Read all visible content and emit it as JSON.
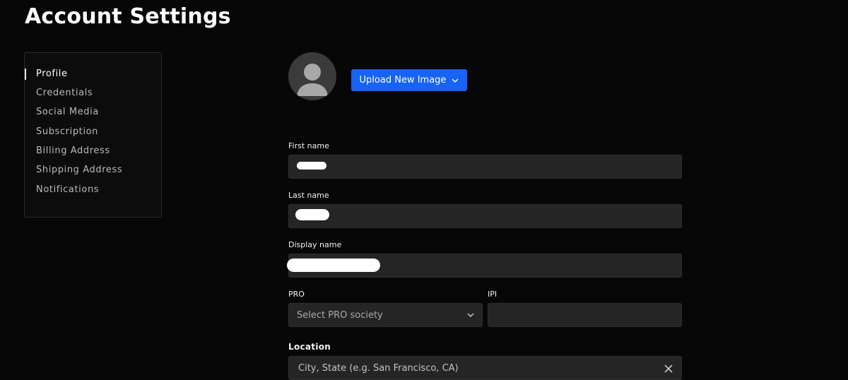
{
  "header": {
    "title": "Account Settings"
  },
  "sidebar": {
    "items": [
      {
        "label": "Profile",
        "active": true
      },
      {
        "label": "Credentials"
      },
      {
        "label": "Social Media"
      },
      {
        "label": "Subscription"
      },
      {
        "label": "Billing Address"
      },
      {
        "label": "Shipping Address"
      },
      {
        "label": "Notifications"
      }
    ]
  },
  "profile": {
    "avatar_icon": "user-silhouette-icon",
    "upload_label": "Upload New Image",
    "upload_icon": "chevron-down-icon",
    "accent_color": "#1663f5",
    "fields": {
      "first_name": {
        "label": "First name",
        "value": ""
      },
      "last_name": {
        "label": "Last name",
        "value": ""
      },
      "display_name": {
        "label": "Display name",
        "value": ""
      },
      "pro": {
        "label": "PRO",
        "placeholder": "Select PRO society"
      },
      "ipi": {
        "label": "IPI",
        "value": ""
      },
      "location": {
        "label": "Location",
        "placeholder": "City, State (e.g. San Francisco, CA)",
        "clear_icon": "close-icon"
      }
    }
  }
}
